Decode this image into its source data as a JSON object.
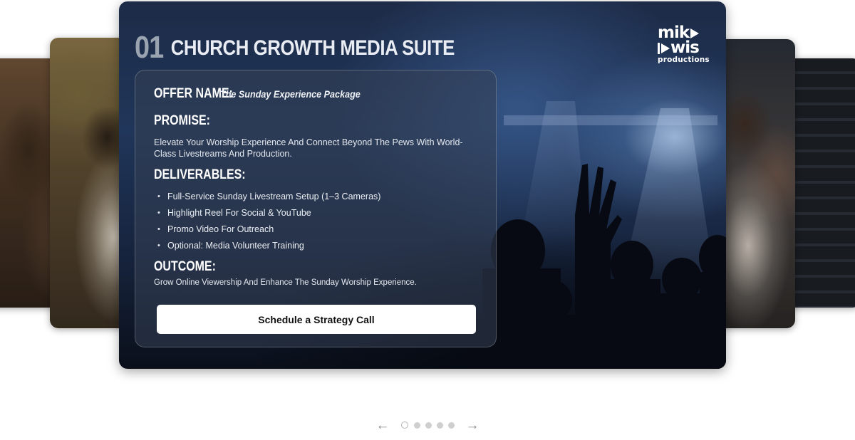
{
  "slide": {
    "number": "01",
    "title": "CHURCH GROWTH MEDIA SUITE"
  },
  "brand": {
    "line1_text": "mik",
    "line2_text": "wis",
    "tagline": "productions"
  },
  "offer": {
    "label": "OFFER NAME:",
    "value": "The Sunday Experience Package"
  },
  "promise": {
    "heading": "PROMISE:",
    "text": "Elevate Your Worship Experience And Connect Beyond The Pews With World-Class Livestreams And Production."
  },
  "deliverables": {
    "heading": "DELIVERABLES:",
    "items": [
      "Full-Service Sunday Livestream Setup (1–3 Cameras)",
      "Highlight Reel For Social & YouTube",
      "Promo Video For Outreach",
      "Optional: Media Volunteer Training"
    ]
  },
  "outcome": {
    "heading": "OUTCOME:",
    "text": "Grow Online Viewership And Enhance The Sunday Worship Experience."
  },
  "cta_label": "Schedule a Strategy Call",
  "carousel": {
    "prev_icon": "arrow-left-icon",
    "next_icon": "arrow-right-icon",
    "prev_glyph": "←",
    "next_glyph": "→",
    "total_slides": 5,
    "active_index": 0
  },
  "colors": {
    "card_overlay": "#344054",
    "cta_background": "#ffffff",
    "dot_inactive": "#cfcfcf",
    "arrow": "#8c8c8c"
  }
}
